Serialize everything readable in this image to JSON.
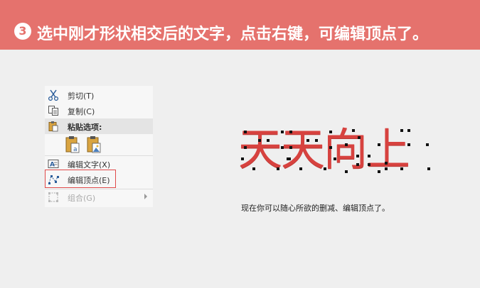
{
  "banner": {
    "step_number": "3",
    "title": "选中刚才形状相交后的文字，点击右键，可编辑顶点了。",
    "color": "#e5726d"
  },
  "context_menu": {
    "items": [
      {
        "label": "剪切(T)",
        "icon": "scissors-icon"
      },
      {
        "label": "复制(C)",
        "icon": "copy-icon"
      },
      {
        "label": "粘贴选项:",
        "icon": "clipboard-icon"
      },
      {
        "label": "编辑文字(X)",
        "icon": "text-box-icon"
      },
      {
        "label": "编辑顶点(E)",
        "icon": "edit-points-icon"
      },
      {
        "label": "组合(G)",
        "icon": "group-icon"
      }
    ],
    "paste_options": [
      "keep-text-paste-icon",
      "picture-paste-icon"
    ],
    "highlight_color": "#e04a4a"
  },
  "canvas": {
    "shape_text": "天天向上",
    "shape_color": "#d7423f",
    "caption": "现在你可以随心所欲的删减、编辑顶点了。"
  }
}
